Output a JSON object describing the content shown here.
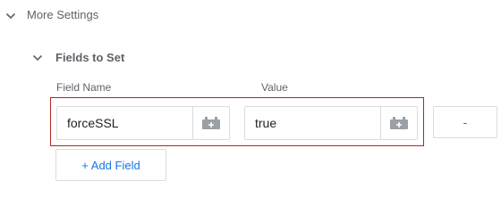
{
  "more_settings": {
    "label": "More Settings",
    "expanded": true,
    "icon": "chevron-down-icon"
  },
  "fields_to_set": {
    "label": "Fields to Set",
    "expanded": true,
    "icon": "chevron-down-icon",
    "columns": {
      "name": "Field Name",
      "value": "Value"
    },
    "rows": [
      {
        "name": "forceSSL",
        "value": "true",
        "variable_icon": "variable-picker-icon",
        "remove_label": "-"
      }
    ],
    "add_label": "+ Add Field"
  },
  "colors": {
    "accent": "#1a73e8",
    "highlight_border": "#b3261e",
    "field_border": "#dadce0",
    "icon_gray": "#9aa0a6"
  }
}
